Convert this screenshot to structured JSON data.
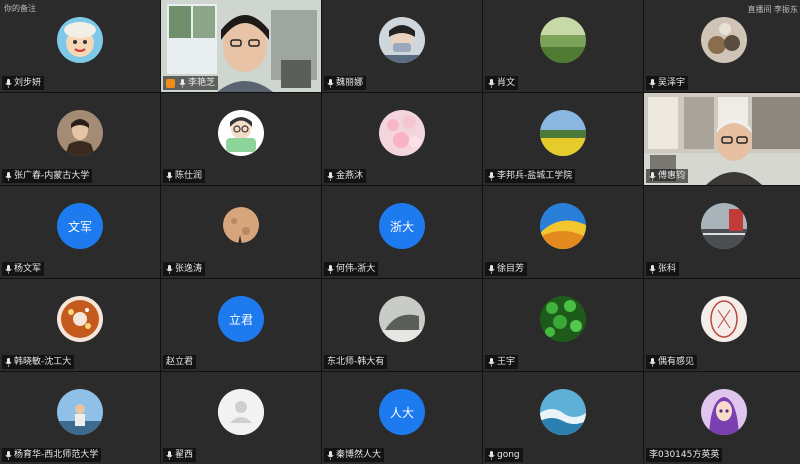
{
  "tiles": [
    {
      "name": "刘步妍",
      "type": "avatar",
      "avatar": "cartoon-face-icon",
      "corner": "你的备注"
    },
    {
      "name": "李艳芝",
      "type": "video",
      "scene": "woman-window",
      "host": true,
      "active": true
    },
    {
      "name": "魏丽娜",
      "type": "avatar",
      "avatar": "masked-person-icon"
    },
    {
      "name": "肖文",
      "type": "avatar",
      "avatar": "landscape-photo-icon"
    },
    {
      "name": "吴泽宇",
      "type": "avatar",
      "avatar": "pets-photo-icon",
      "corner_right": "直播间  李振东"
    },
    {
      "name": "张广春-内蒙古大学",
      "type": "avatar",
      "avatar": "man-portrait-icon"
    },
    {
      "name": "陈仕润",
      "type": "avatar",
      "avatar": "cartoon-girl-icon"
    },
    {
      "name": "金燕沐",
      "type": "avatar",
      "avatar": "flowers-photo-icon"
    },
    {
      "name": "李邦兵-盐城工学院",
      "type": "avatar",
      "avatar": "field-photo-icon"
    },
    {
      "name": "傅惠钧",
      "type": "video",
      "scene": "man-bookshelf"
    },
    {
      "name": "杨文军",
      "type": "text",
      "avatar_text": "文军"
    },
    {
      "name": "张逸涛",
      "type": "avatar",
      "avatar": "moon-photo-icon"
    },
    {
      "name": "何伟-浙大",
      "type": "text",
      "avatar_text": "浙大"
    },
    {
      "name": "徐目芳",
      "type": "avatar",
      "avatar": "abstract-art-icon"
    },
    {
      "name": "张科",
      "type": "avatar",
      "avatar": "road-photo-icon"
    },
    {
      "name": "韩晓敏-沈工大",
      "type": "avatar",
      "avatar": "donut-photo-icon"
    },
    {
      "name": "赵立君",
      "type": "text",
      "avatar_text": "立君",
      "nomic": true
    },
    {
      "name": "东北师-韩大有",
      "type": "avatar",
      "avatar": "sketch-photo-icon",
      "nomic": true
    },
    {
      "name": "王宇",
      "type": "avatar",
      "avatar": "clover-photo-icon"
    },
    {
      "name": "偶有感见",
      "type": "avatar",
      "avatar": "red-drawing-icon"
    },
    {
      "name": "杨育华-西北师范大学",
      "type": "avatar",
      "avatar": "person-sky-icon"
    },
    {
      "name": "翟西",
      "type": "blank",
      "avatar": "default-user-icon"
    },
    {
      "name": "秦博然人大",
      "type": "text",
      "avatar_text": "人大"
    },
    {
      "name": "gong",
      "type": "avatar",
      "avatar": "waves-photo-icon"
    },
    {
      "name": "李030145方英英",
      "type": "avatar",
      "avatar": "anime-girl-icon",
      "nomic": true
    }
  ]
}
